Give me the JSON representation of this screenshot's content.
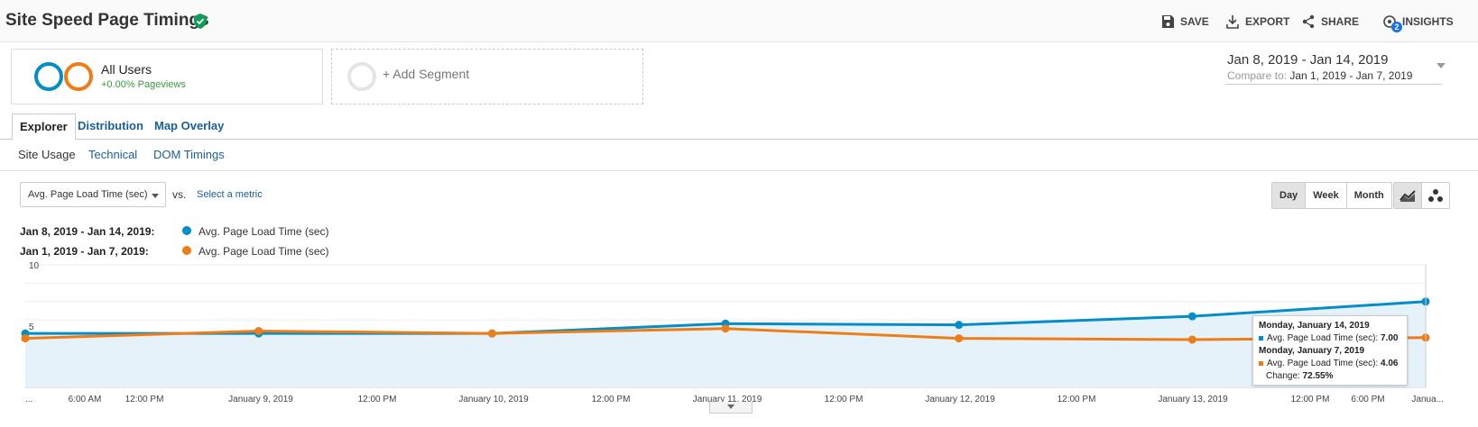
{
  "header": {
    "title": "Site Speed Page Timings",
    "actions": {
      "save": "SAVE",
      "export": "EXPORT",
      "share": "SHARE",
      "insights": "INSIGHTS",
      "insights_badge": "2"
    }
  },
  "segments": {
    "all_users": {
      "title": "All Users",
      "subtitle": "+0.00% Pageviews"
    },
    "add_segment": "+ Add Segment"
  },
  "date_range": {
    "main": "Jan 8, 2019 - Jan 14, 2019",
    "compare_label": "Compare to:",
    "compare_value": "Jan 1, 2019 - Jan 7, 2019"
  },
  "tabs": [
    "Explorer",
    "Distribution",
    "Map Overlay"
  ],
  "subtabs": [
    "Site Usage",
    "Technical",
    "DOM Timings"
  ],
  "metric_select": {
    "value": "Avg. Page Load Time (sec)",
    "vs": "vs.",
    "select_metric": "Select a metric"
  },
  "period_buttons": [
    "Day",
    "Week",
    "Month"
  ],
  "legend": [
    {
      "range": "Jan 8, 2019 - Jan 14, 2019:",
      "metric": "Avg. Page Load Time (sec)",
      "color": "#058dc7"
    },
    {
      "range": "Jan 1, 2019 - Jan 7, 2019:",
      "metric": "Avg. Page Load Time (sec)",
      "color": "#ed7e17"
    }
  ],
  "chart_data": {
    "type": "line",
    "y_ticks": [
      "10",
      "5"
    ],
    "ylim": [
      0,
      10
    ],
    "x_labels": [
      "...",
      "6:00 AM",
      "12:00 PM",
      "January 9, 2019",
      "12:00 PM",
      "January 10, 2019",
      "12:00 PM",
      "January 11, 2019",
      "12:00 PM",
      "January 12, 2019",
      "12:00 PM",
      "January 13, 2019",
      "12:00 PM",
      "6:00 PM",
      "Janua..."
    ],
    "categories": [
      "Jan 8",
      "Jan 9",
      "Jan 10",
      "Jan 11",
      "Jan 12",
      "Jan 13",
      "Jan 14"
    ],
    "series": [
      {
        "name": "Jan 8, 2019 - Jan 14, 2019",
        "values": [
          4.4,
          4.4,
          4.4,
          5.2,
          5.1,
          5.8,
          7.0
        ],
        "color": "#058dc7"
      },
      {
        "name": "Jan 1, 2019 - Jan 7, 2019",
        "values": [
          4.0,
          4.6,
          4.4,
          4.8,
          4.0,
          3.9,
          4.06
        ],
        "color": "#ed7e17"
      }
    ],
    "tooltip": {
      "date1": "Monday, January 14, 2019",
      "metric1": "Avg. Page Load Time (sec):",
      "value1": "7.00",
      "date2": "Monday, January 7, 2019",
      "metric2": "Avg. Page Load Time (sec):",
      "value2": "4.06",
      "change_label": "Change:",
      "change_value": "72.55%"
    }
  }
}
